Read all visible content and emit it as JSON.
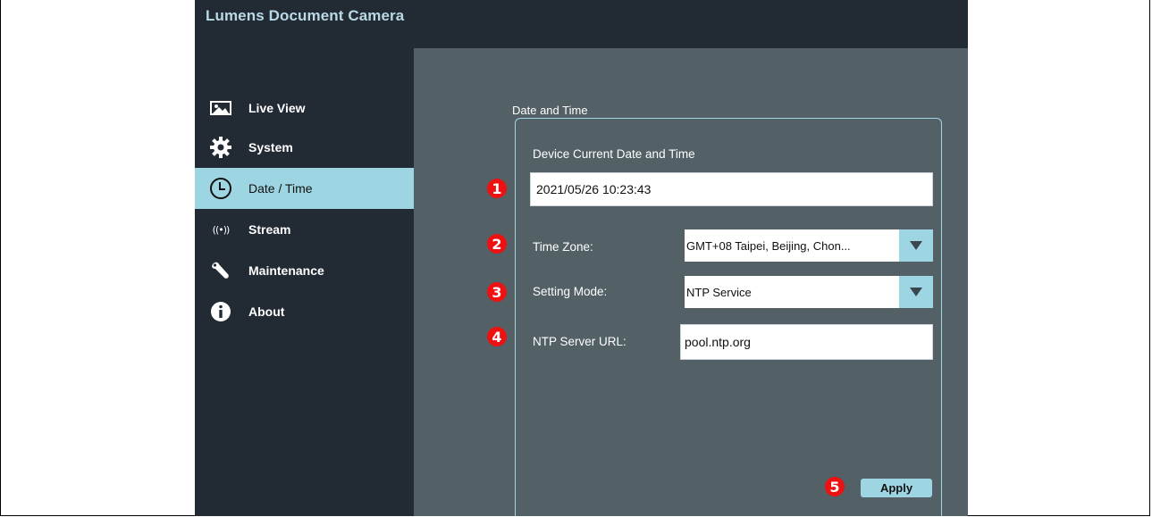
{
  "app": {
    "title": "Lumens Document Camera"
  },
  "sidebar": {
    "items": [
      {
        "label": "Live View",
        "icon": "image-icon"
      },
      {
        "label": "System",
        "icon": "gear-icon"
      },
      {
        "label": "Date / Time",
        "icon": "clock-icon",
        "active": true
      },
      {
        "label": "Stream",
        "icon": "broadcast-icon",
        "glyph": "((•))"
      },
      {
        "label": "Maintenance",
        "icon": "wrench-icon"
      },
      {
        "label": "About",
        "icon": "info-icon"
      }
    ]
  },
  "main": {
    "section_title": "Date and Time",
    "current_label": "Device Current Date and Time",
    "current_value": "2021/05/26 10:23:43",
    "timezone_label": "Time Zone:",
    "timezone_value": "GMT+08 Taipei, Beijing, Chon...",
    "mode_label": "Setting Mode:",
    "mode_value": "NTP Service",
    "ntp_label": "NTP Server URL:",
    "ntp_value": "pool.ntp.org",
    "apply_label": "Apply"
  },
  "badges": [
    "1",
    "2",
    "3",
    "4",
    "5"
  ],
  "colors": {
    "sidebar_bg": "#222a34",
    "content_bg": "#536066",
    "accent": "#9dd6e2",
    "badge": "#ee1111"
  }
}
